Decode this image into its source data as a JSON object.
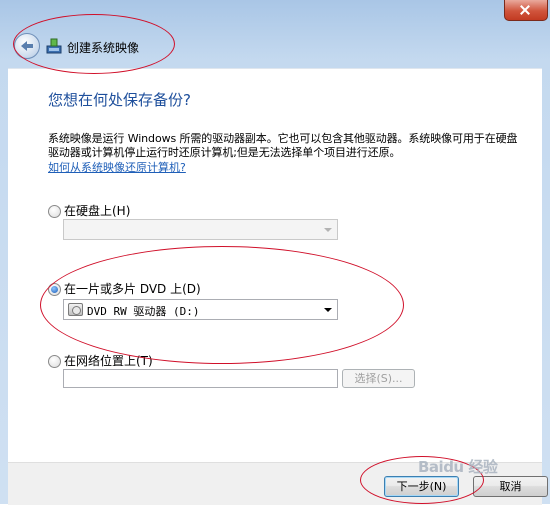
{
  "window": {
    "title": "创建系统映像"
  },
  "page": {
    "heading": "您想在何处保存备份?",
    "description": "系统映像是运行 Windows 所需的驱动器副本。它也可以包含其他驱动器。系统映像可用于在硬盘驱动器或计算机停止运行时还原计算机;但是无法选择单个项目进行还原。",
    "help_link": "如何从系统映像还原计算机?"
  },
  "options": {
    "hard_disk": {
      "label": "在硬盘上(H)",
      "selected": false,
      "dropdown_value": ""
    },
    "dvd": {
      "label": "在一片或多片 DVD 上(D)",
      "selected": true,
      "dropdown_value": "DVD RW 驱动器 (D:)"
    },
    "network": {
      "label": "在网络位置上(T)",
      "selected": false,
      "path_value": "",
      "select_button": "选择(S)..."
    }
  },
  "footer": {
    "next_button": "下一步(N)",
    "cancel_button": "取消"
  },
  "watermark": "Baidu 经验",
  "colors": {
    "heading": "#1e4f9c",
    "link": "#1f5fb8",
    "annotation": "#d0102a"
  }
}
